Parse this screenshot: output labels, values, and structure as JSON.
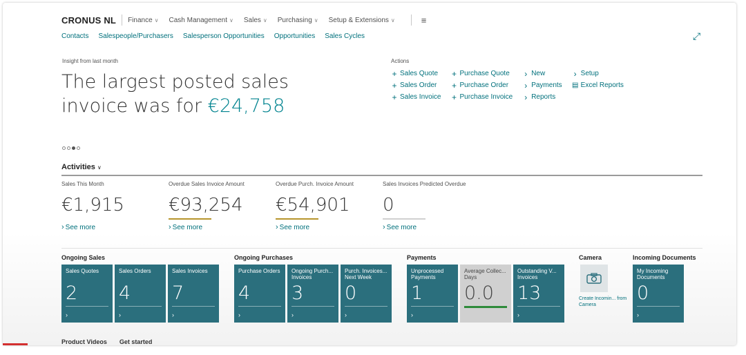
{
  "nav": {
    "company": "CRONUS NL",
    "menu": [
      "Finance",
      "Cash Management",
      "Sales",
      "Purchasing",
      "Setup & Extensions"
    ],
    "subnav": [
      "Contacts",
      "Salespeople/Purchasers",
      "Salesperson Opportunities",
      "Opportunities",
      "Sales Cycles"
    ]
  },
  "insight": {
    "label": "Insight from last month",
    "headline_line1": "The largest posted sales",
    "headline_line2": "invoice was for ",
    "amount": "€24,758"
  },
  "actions": {
    "title": "Actions",
    "columns": [
      [
        {
          "icon": "plus-icon",
          "label": "Sales Quote"
        },
        {
          "icon": "plus-icon",
          "label": "Sales Order"
        },
        {
          "icon": "plus-icon",
          "label": "Sales Invoice"
        }
      ],
      [
        {
          "icon": "plus-icon",
          "label": "Purchase Quote"
        },
        {
          "icon": "plus-icon",
          "label": "Purchase Order"
        },
        {
          "icon": "plus-icon",
          "label": "Purchase Invoice"
        }
      ],
      [
        {
          "icon": "chevron-right-icon",
          "label": "New"
        },
        {
          "icon": "chevron-right-icon",
          "label": "Payments"
        },
        {
          "icon": "chevron-right-icon",
          "label": "Reports"
        }
      ],
      [
        {
          "icon": "chevron-right-icon",
          "label": "Setup"
        },
        {
          "icon": "report-icon",
          "label": "Excel Reports"
        }
      ]
    ]
  },
  "activities": {
    "title": "Activities",
    "see_more": "See more",
    "cues": [
      {
        "label": "Sales This Month",
        "value": "€1,915",
        "status": "neutral"
      },
      {
        "label": "Overdue Sales Invoice Amount",
        "value": "€93,254",
        "status": "warning"
      },
      {
        "label": "Overdue Purch. Invoice Amount",
        "value": "€54,901",
        "status": "warning"
      },
      {
        "label": "Sales Invoices Predicted Overdue",
        "value": "0",
        "status": "neutral"
      }
    ]
  },
  "tiles": {
    "groups": [
      {
        "title": "Ongoing Sales",
        "items": [
          {
            "label": "Sales Quotes",
            "value": "2"
          },
          {
            "label": "Sales Orders",
            "value": "4"
          },
          {
            "label": "Sales Invoices",
            "value": "7"
          }
        ]
      },
      {
        "title": "Ongoing Purchases",
        "items": [
          {
            "label": "Purchase Orders",
            "value": "4"
          },
          {
            "label": "Ongoing Purch... Invoices",
            "value": "3"
          },
          {
            "label": "Purch. Invoices... Next Week",
            "value": "0"
          }
        ]
      },
      {
        "title": "Payments",
        "items": [
          {
            "label": "Unprocessed Payments",
            "value": "1"
          },
          {
            "label": "Average Collec... Days",
            "value": "0.0"
          },
          {
            "label": "Outstanding V... Invoices",
            "value": "13"
          }
        ]
      },
      {
        "title": "Camera",
        "camera_label": "Create Incomin... from Camera"
      },
      {
        "title": "Incoming Documents",
        "items": [
          {
            "label": "My Incoming Documents",
            "value": "0"
          }
        ]
      }
    ]
  },
  "bottom_tabs": [
    "Product Videos",
    "Get started"
  ],
  "colors": {
    "accent": "#00707c",
    "tile": "#2b6f7d",
    "warning": "#b7952c",
    "good": "#2e8b3a"
  }
}
